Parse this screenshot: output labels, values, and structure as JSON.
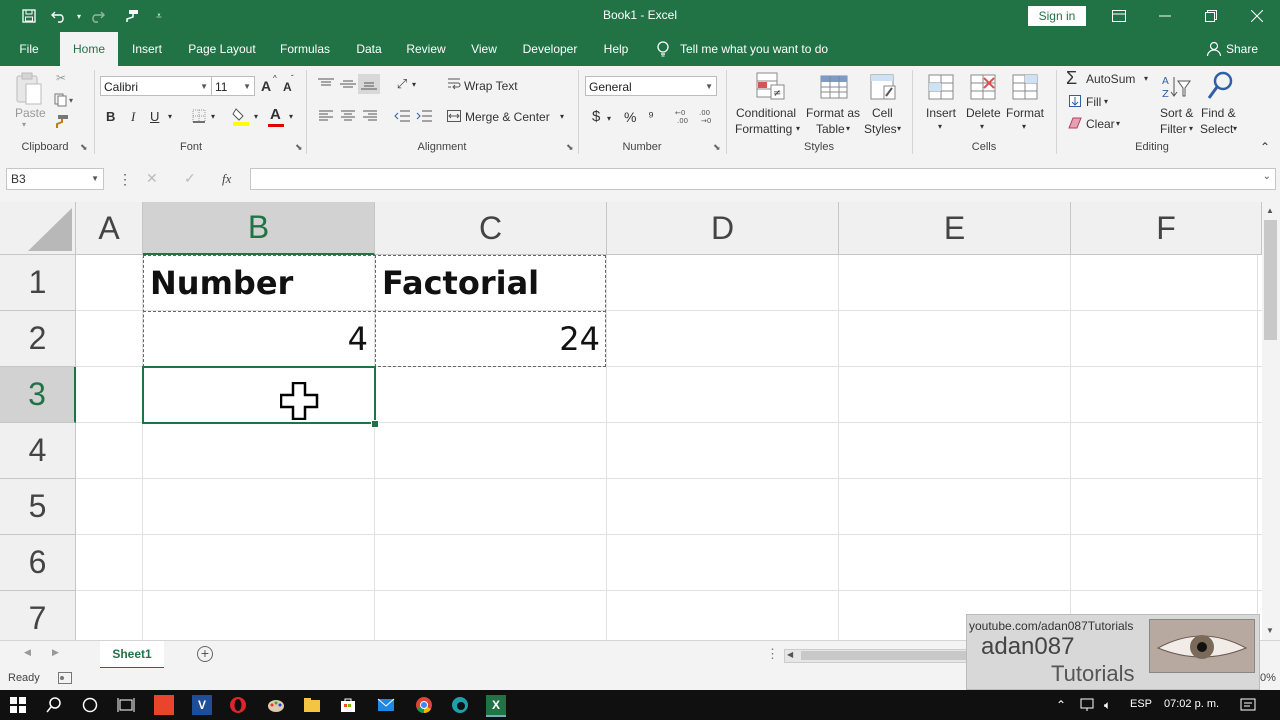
{
  "window": {
    "title": "Book1  -  Excel",
    "sign_in": "Sign in"
  },
  "colors": {
    "excel_green": "#217346",
    "ribbon_bg": "#f3f3f3",
    "header_bg": "#f0f0f0",
    "header_selected": "#d2d2d2"
  },
  "tabs": [
    "File",
    "Home",
    "Insert",
    "Page Layout",
    "Formulas",
    "Data",
    "Review",
    "View",
    "Developer",
    "Help"
  ],
  "tell_me": "Tell me what you want to do",
  "share": "Share",
  "ribbon": {
    "clipboard": {
      "paste": "Paste",
      "label": "Clipboard"
    },
    "font": {
      "name": "Calibri",
      "size": "11",
      "bold": "B",
      "italic": "I",
      "underline": "U",
      "grow": "A",
      "shrink": "A",
      "color_a": "A",
      "label": "Font"
    },
    "alignment": {
      "wrap_text": "Wrap Text",
      "merge_center": "Merge & Center",
      "label": "Alignment"
    },
    "number": {
      "format": "General",
      "currency": "$",
      "percent": "%",
      "comma": "⁹",
      "label": "Number"
    },
    "styles": {
      "conditional_1": "Conditional",
      "conditional_2": "Formatting",
      "format_table_1": "Format as",
      "format_table_2": "Table",
      "cell_styles_1": "Cell",
      "cell_styles_2": "Styles",
      "label": "Styles"
    },
    "cells": {
      "insert": "Insert",
      "delete": "Delete",
      "format": "Format",
      "label": "Cells"
    },
    "editing": {
      "autosum": "AutoSum",
      "fill": "Fill",
      "clear": "Clear",
      "sort_1": "Sort &",
      "sort_2": "Filter",
      "find_1": "Find &",
      "find_2": "Select",
      "label": "Editing"
    }
  },
  "formula_bar": {
    "name_box": "B3",
    "fx": "fx",
    "value": ""
  },
  "columns": [
    "A",
    "B",
    "C",
    "D",
    "E",
    "F"
  ],
  "rows": [
    "1",
    "2",
    "3",
    "4",
    "5",
    "6",
    "7"
  ],
  "cells": {
    "B1": "Number",
    "C1": "Factorial",
    "B2": "4",
    "C2": "24"
  },
  "selected_cell": "B3",
  "sheet": {
    "name": "Sheet1"
  },
  "status": {
    "ready": "Ready",
    "zoom": "0%"
  },
  "watermark": {
    "url": "youtube.com/adan087Tutorials",
    "name": "adan087",
    "sub": "Tutorials"
  },
  "taskbar": {
    "lang": "ESP",
    "time": "07:02 p. m."
  }
}
